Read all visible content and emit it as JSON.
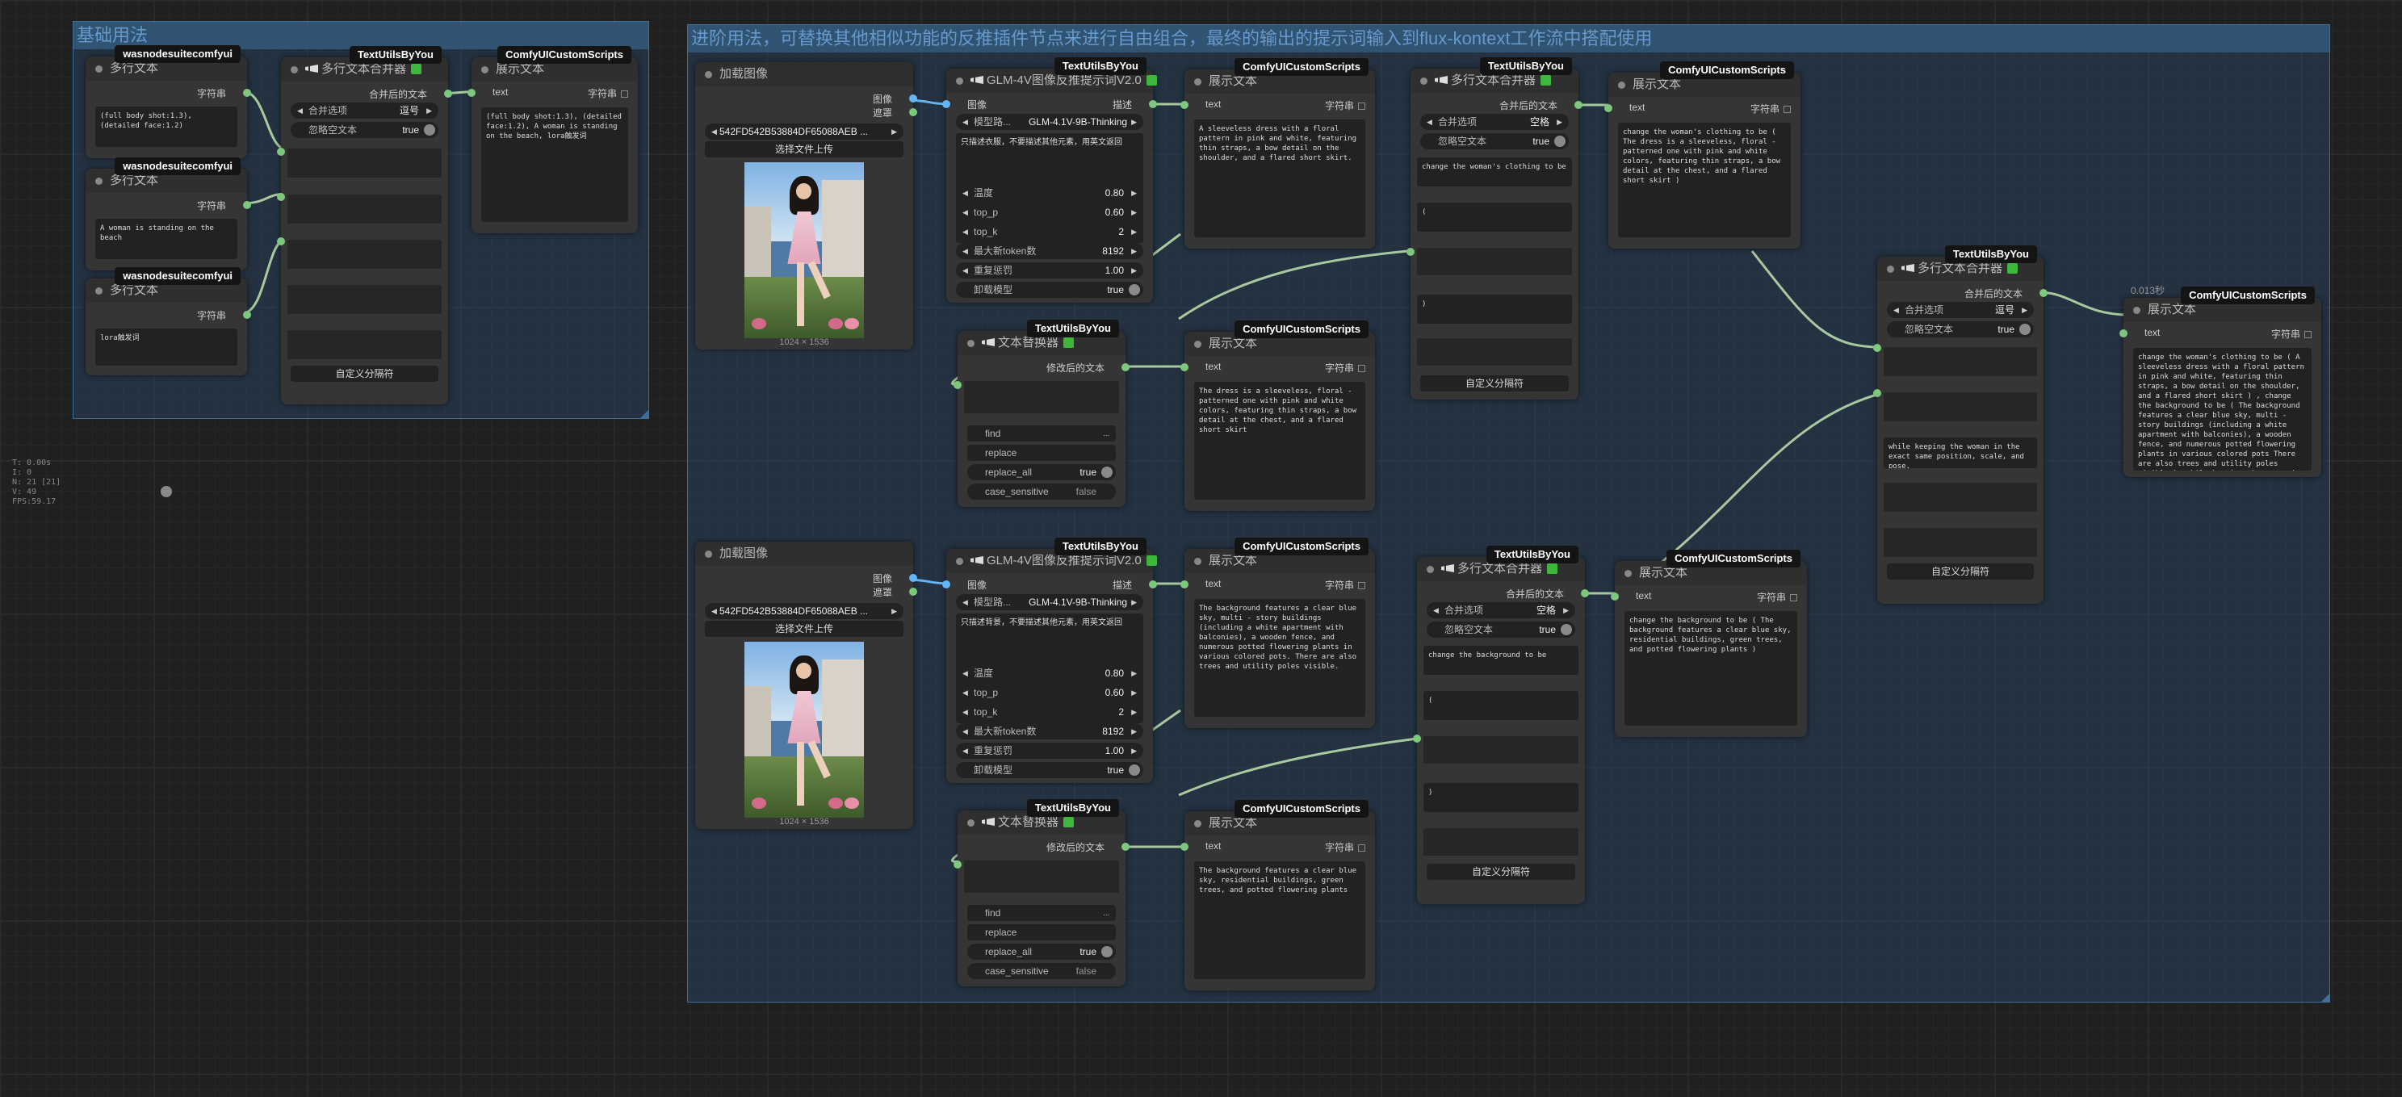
{
  "stats": [
    "T: 0.00s",
    "I: 0",
    "N: 21 [21]",
    "V: 49",
    "FPS:59.17"
  ],
  "groups": {
    "basic": "基础用法",
    "advanced": "进阶用法，可替换其他相似功能的反推插件节点来进行自由组合，最终的输出的提示词输入到flux-kontext工作流中搭配使用"
  },
  "badges": {
    "was": "wasnodesuitecomfyui",
    "tu": "TextUtilsByYou",
    "cs": "ComfyUICustomScripts"
  },
  "titles": {
    "multiline": "多行文本",
    "merger": "多行文本合并器",
    "show": "展示文本",
    "load_image": "加载图像",
    "glm": "GLM-4V图像反推提示词V2.0",
    "replacer": "文本替换器"
  },
  "slots": {
    "string": "字符串",
    "merged": "合并后的文本",
    "text": "text",
    "image": "图像",
    "mask": "遮罩",
    "describe": "描述",
    "modified": "修改后的文本"
  },
  "widgets": {
    "merge_option": "合并选项",
    "ignore_empty": "忽略空文本",
    "true": "true",
    "false": "false",
    "newline": "逗号",
    "space": "空格",
    "custom_sep": "自定义分隔符",
    "model": "模型路...",
    "model_value": "GLM-4.1V-9B-Thinking",
    "temperature": "温度",
    "temperature_value": "0.80",
    "top_p": "top_p",
    "top_p_value": "0.60",
    "top_k": "top_k",
    "top_k_value": "2",
    "max_tokens": "最大新token数",
    "max_tokens_value": "8192",
    "repeat_penalty": "重复惩罚",
    "repeat_penalty_value": "1.00",
    "unload": "卸载模型",
    "find": "find",
    "replace": "replace",
    "replace_all": "replace_all",
    "case_sensitive": "case_sensitive",
    "image_file": "542FD542B53884DF65088AEB ...",
    "upload": "选择文件上传",
    "dims": "1024 × 1536",
    "timing": "0.013秒"
  },
  "texts": {
    "basic_1": "(full body shot:1.3), (detailed face:1.2)",
    "basic_2": "A woman is standing on the beach",
    "basic_3": "lora触发词",
    "basic_out": "(full body shot:1.3), (detailed face:1.2), A woman is standing on the beach, lora触发词",
    "glm_prompt_1": "只描述衣服，不要描述其他元素，用英文返回",
    "glm_prompt_2": "只描述背景，不要描述其他元素，用英文返回",
    "show_a1": "A sleeveless dress with a floral pattern in pink and white, featuring thin straps, a bow detail on the shoulder, and a flared short skirt.",
    "show_a2": "The dress is a sleeveless, floral - patterned one with pink and white colors, featuring thin straps, a bow detail at the chest, and a flared short skirt",
    "merge_a1": "change the woman's clothing to be",
    "merge_a2": "(",
    "merge_a3": ")",
    "show_a3": "change the woman's clothing to be ( The dress is a sleeveless, floral - patterned one with pink and white colors, featuring thin straps, a bow detail at the chest, and a flared short skirt )",
    "show_b1": "The background features a clear blue sky, multi - story buildings (including a white apartment with balconies), a wooden fence, and numerous potted flowering plants in various colored pots. There are also trees and utility poles visible.",
    "show_b2": "The background features a clear blue sky, residential buildings, green trees, and potted flowering plants",
    "merge_b1": "change the background to be",
    "show_b3": "change the background to be ( The background features a clear blue sky, residential buildings, green trees, and potted flowering plants )",
    "final_mid": "while keeping the woman in the exact same position, scale, and pose.",
    "final_out": "change the woman's clothing to be ( A sleeveless dress with a floral pattern in pink and white, featuring thin straps, a bow detail on the shoulder, and a flared short skirt ) , change the background to be ( The background features a clear blue sky, multi - story buildings (including a white apartment with balconies), a wooden fence, and numerous potted flowering plants in various colored pots There are also trees and utility poles visible ), while keeping the woman in the exact same position, scale, and pose."
  },
  "colors": {
    "link": "#a8c8a0",
    "image_link": "#64b5f6",
    "slot": "#7ec87e",
    "check": "#3db83d",
    "group": "#3d6f99"
  }
}
